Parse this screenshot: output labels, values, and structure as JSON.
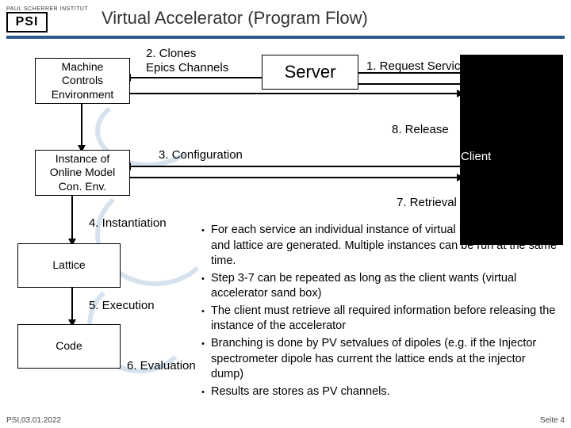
{
  "header": {
    "institute": "PAUL SCHERRER INSTITUT",
    "logo": "PSI",
    "title": "Virtual Accelerator (Program Flow)"
  },
  "boxes": {
    "machine": "Machine\nControls\nEnvironment",
    "server": "Server",
    "client": "Client",
    "instance": "Instance of\nOnline Model\nCon. Env.",
    "lattice": "Lattice",
    "code": "Code"
  },
  "labels": {
    "l1": "1. Request Service",
    "l2a": "2. Clones",
    "l2b": "Epics Channels",
    "l3": "3. Configuration",
    "l4": "4. Instantiation",
    "l5": "5. Execution",
    "l6": "6. Evaluation",
    "l7": "7. Retrieval",
    "l8": "8. Release"
  },
  "bullets": [
    "For each service an individual instance of virtual EPICS channels and lattice are generated. Multiple instances can be run at the same time.",
    "Step 3-7 can be repeated as long as the client wants (virtual accelerator sand box)",
    "The client must retrieve all required information before releasing the instance of the accelerator",
    "Branching is done by PV setvalues of dipoles (e.g. if the Injector spectrometer dipole has current the lattice ends at the injector dump)",
    "Results are stores as PV channels."
  ],
  "footer": {
    "left": "PSI,03.01.2022",
    "right": "Seite 4"
  }
}
